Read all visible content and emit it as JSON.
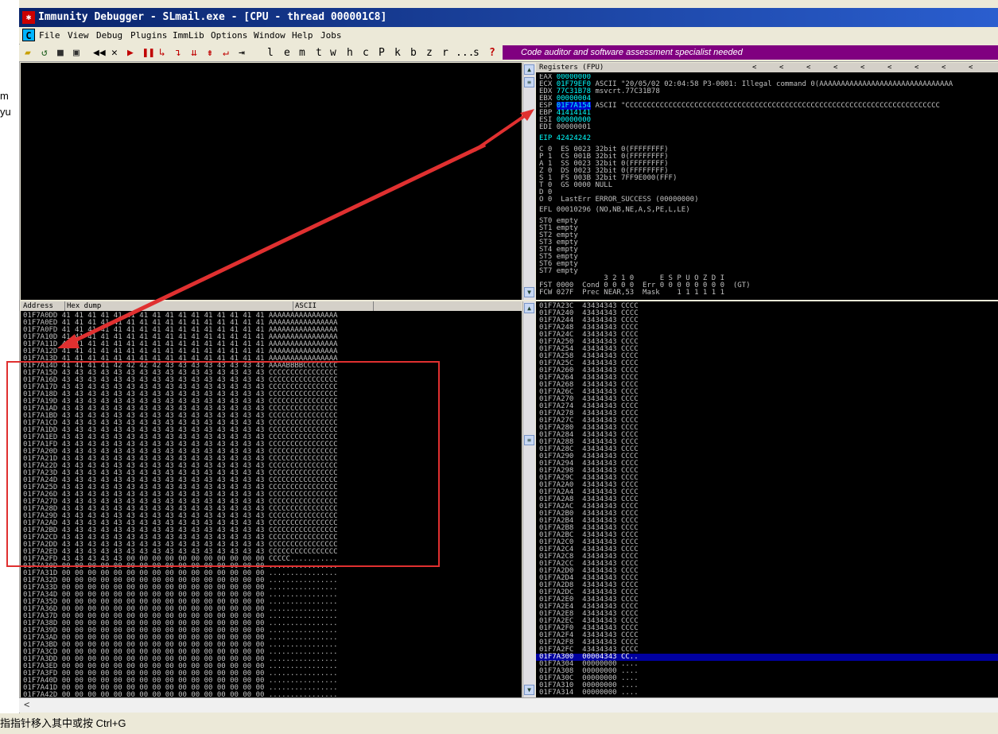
{
  "window": {
    "title": "Immunity Debugger - SLmail.exe - [CPU - thread 000001C8]"
  },
  "left_gutter": {
    "fragments": [
      "m",
      "yu"
    ]
  },
  "menu": {
    "icon_letter": "C",
    "items": [
      "File",
      "View",
      "Debug",
      "Plugins",
      "ImmLib",
      "Options",
      "Window",
      "Help",
      "Jobs"
    ]
  },
  "toolbar": {
    "letters": [
      "l",
      "e",
      "m",
      "t",
      "w",
      "h",
      "c",
      "P",
      "k",
      "b",
      "z",
      "r",
      "...",
      "s",
      "?"
    ],
    "banner": "Code auditor and software assessment specialist needed"
  },
  "registers": {
    "header": "Registers (FPU)",
    "lines": [
      {
        "name": "EAX",
        "value": "00000000",
        "rest": ""
      },
      {
        "name": "ECX",
        "value": "01F79EF0",
        "rest": "ASCII \"20/05/02 02:04:58 P3-0001: Illegal command 0(AAAAAAAAAAAAAAAAAAAAAAAAAAAAAAA"
      },
      {
        "name": "EDX",
        "value": "77C31B78",
        "rest": "msvcrt.77C31B78"
      },
      {
        "name": "EBX",
        "value": "00000004",
        "rest": ""
      },
      {
        "name": "ESP",
        "value": "01F7A154",
        "rest": "ASCII \"CCCCCCCCCCCCCCCCCCCCCCCCCCCCCCCCCCCCCCCCCCCCCCCCCCCCCCCCCCCCCCCCCCCCCCCCC"
      },
      {
        "name": "EBP",
        "value": "41414141",
        "rest": ""
      },
      {
        "name": "ESI",
        "value": "00000000",
        "rest": ""
      },
      {
        "name": "EDI",
        "value": "00000001",
        "rest": ""
      }
    ],
    "eip": "EIP 42424242",
    "flags": [
      "C 0  ES 0023 32bit 0(FFFFFFFF)",
      "P 1  CS 001B 32bit 0(FFFFFFFF)",
      "A 1  SS 0023 32bit 0(FFFFFFFF)",
      "Z 0  DS 0023 32bit 0(FFFFFFFF)",
      "S 1  FS 003B 32bit 7FF9E000(FFF)",
      "T 0  GS 0000 NULL",
      "D 0",
      "O 0  LastErr ERROR_SUCCESS (00000000)"
    ],
    "efl": "EFL 00010296 (NO,NB,NE,A,S,PE,L,LE)",
    "fpu": [
      "ST0 empty",
      "ST1 empty",
      "ST2 empty",
      "ST3 empty",
      "ST4 empty",
      "ST5 empty",
      "ST6 empty",
      "ST7 empty"
    ],
    "fpu_bits": "               3 2 1 0      E S P U O Z D I",
    "fst": "FST 0000  Cond 0 0 0 0  Err 0 0 0 0 0 0 0 0  (GT)",
    "fcw": "FCW 027F  Prec NEAR,53  Mask    1 1 1 1 1 1"
  },
  "dump": {
    "col_address": "Address",
    "col_hex": "Hex dump",
    "col_ascii": "ASCII",
    "rows": [
      "01F7A0DD 41 41 41 41 41 41 41 41 41 41 41 41 41 41 41 41 AAAAAAAAAAAAAAAA",
      "01F7A0ED 41 41 41 41 41 41 41 41 41 41 41 41 41 41 41 41 AAAAAAAAAAAAAAAA",
      "01F7A0FD 41 41 41 41 41 41 41 41 41 41 41 41 41 41 41 41 AAAAAAAAAAAAAAAA",
      "01F7A10D 41 41 41 41 41 41 41 41 41 41 41 41 41 41 41 41 AAAAAAAAAAAAAAAA",
      "01F7A11D 41 41 41 41 41 41 41 41 41 41 41 41 41 41 41 41 AAAAAAAAAAAAAAAA",
      "01F7A12D 41 41 41 41 41 41 41 41 41 41 41 41 41 41 41 41 AAAAAAAAAAAAAAAA",
      "01F7A13D 41 41 41 41 41 41 41 41 41 41 41 41 41 41 41 41 AAAAAAAAAAAAAAAA",
      "01F7A14D 41 41 41 41 42 42 42 42 43 43 43 43 43 43 43 43 AAAABBBBCCCCCCCC",
      "01F7A15D 43 43 43 43 43 43 43 43 43 43 43 43 43 43 43 43 CCCCCCCCCCCCCCCC",
      "01F7A16D 43 43 43 43 43 43 43 43 43 43 43 43 43 43 43 43 CCCCCCCCCCCCCCCC",
      "01F7A17D 43 43 43 43 43 43 43 43 43 43 43 43 43 43 43 43 CCCCCCCCCCCCCCCC",
      "01F7A18D 43 43 43 43 43 43 43 43 43 43 43 43 43 43 43 43 CCCCCCCCCCCCCCCC",
      "01F7A19D 43 43 43 43 43 43 43 43 43 43 43 43 43 43 43 43 CCCCCCCCCCCCCCCC",
      "01F7A1AD 43 43 43 43 43 43 43 43 43 43 43 43 43 43 43 43 CCCCCCCCCCCCCCCC",
      "01F7A1BD 43 43 43 43 43 43 43 43 43 43 43 43 43 43 43 43 CCCCCCCCCCCCCCCC",
      "01F7A1CD 43 43 43 43 43 43 43 43 43 43 43 43 43 43 43 43 CCCCCCCCCCCCCCCC",
      "01F7A1DD 43 43 43 43 43 43 43 43 43 43 43 43 43 43 43 43 CCCCCCCCCCCCCCCC",
      "01F7A1ED 43 43 43 43 43 43 43 43 43 43 43 43 43 43 43 43 CCCCCCCCCCCCCCCC",
      "01F7A1FD 43 43 43 43 43 43 43 43 43 43 43 43 43 43 43 43 CCCCCCCCCCCCCCCC",
      "01F7A20D 43 43 43 43 43 43 43 43 43 43 43 43 43 43 43 43 CCCCCCCCCCCCCCCC",
      "01F7A21D 43 43 43 43 43 43 43 43 43 43 43 43 43 43 43 43 CCCCCCCCCCCCCCCC",
      "01F7A22D 43 43 43 43 43 43 43 43 43 43 43 43 43 43 43 43 CCCCCCCCCCCCCCCC",
      "01F7A23D 43 43 43 43 43 43 43 43 43 43 43 43 43 43 43 43 CCCCCCCCCCCCCCCC",
      "01F7A24D 43 43 43 43 43 43 43 43 43 43 43 43 43 43 43 43 CCCCCCCCCCCCCCCC",
      "01F7A25D 43 43 43 43 43 43 43 43 43 43 43 43 43 43 43 43 CCCCCCCCCCCCCCCC",
      "01F7A26D 43 43 43 43 43 43 43 43 43 43 43 43 43 43 43 43 CCCCCCCCCCCCCCCC",
      "01F7A27D 43 43 43 43 43 43 43 43 43 43 43 43 43 43 43 43 CCCCCCCCCCCCCCCC",
      "01F7A28D 43 43 43 43 43 43 43 43 43 43 43 43 43 43 43 43 CCCCCCCCCCCCCCCC",
      "01F7A29D 43 43 43 43 43 43 43 43 43 43 43 43 43 43 43 43 CCCCCCCCCCCCCCCC",
      "01F7A2AD 43 43 43 43 43 43 43 43 43 43 43 43 43 43 43 43 CCCCCCCCCCCCCCCC",
      "01F7A2BD 43 43 43 43 43 43 43 43 43 43 43 43 43 43 43 43 CCCCCCCCCCCCCCCC",
      "01F7A2CD 43 43 43 43 43 43 43 43 43 43 43 43 43 43 43 43 CCCCCCCCCCCCCCCC",
      "01F7A2DD 43 43 43 43 43 43 43 43 43 43 43 43 43 43 43 43 CCCCCCCCCCCCCCCC",
      "01F7A2ED 43 43 43 43 43 43 43 43 43 43 43 43 43 43 43 43 CCCCCCCCCCCCCCCC",
      "01F7A2FD 43 43 43 43 43 00 00 00 00 00 00 00 00 00 00 00 CCCCC...........",
      "01F7A30D 00 00 00 00 00 00 00 00 00 00 00 00 00 00 00 00 ................",
      "01F7A31D 00 00 00 00 00 00 00 00 00 00 00 00 00 00 00 00 ................",
      "01F7A32D 00 00 00 00 00 00 00 00 00 00 00 00 00 00 00 00 ................",
      "01F7A33D 00 00 00 00 00 00 00 00 00 00 00 00 00 00 00 00 ................",
      "01F7A34D 00 00 00 00 00 00 00 00 00 00 00 00 00 00 00 00 ................",
      "01F7A35D 00 00 00 00 00 00 00 00 00 00 00 00 00 00 00 00 ................",
      "01F7A36D 00 00 00 00 00 00 00 00 00 00 00 00 00 00 00 00 ................",
      "01F7A37D 00 00 00 00 00 00 00 00 00 00 00 00 00 00 00 00 ................",
      "01F7A38D 00 00 00 00 00 00 00 00 00 00 00 00 00 00 00 00 ................",
      "01F7A39D 00 00 00 00 00 00 00 00 00 00 00 00 00 00 00 00 ................",
      "01F7A3AD 00 00 00 00 00 00 00 00 00 00 00 00 00 00 00 00 ................",
      "01F7A3BD 00 00 00 00 00 00 00 00 00 00 00 00 00 00 00 00 ................",
      "01F7A3CD 00 00 00 00 00 00 00 00 00 00 00 00 00 00 00 00 ................",
      "01F7A3DD 00 00 00 00 00 00 00 00 00 00 00 00 00 00 00 00 ................",
      "01F7A3ED 00 00 00 00 00 00 00 00 00 00 00 00 00 00 00 00 ................",
      "01F7A3FD 00 00 00 00 00 00 00 00 00 00 00 00 00 00 00 00 ................",
      "01F7A40D 00 00 00 00 00 00 00 00 00 00 00 00 00 00 00 00 ................",
      "01F7A41D 00 00 00 00 00 00 00 00 00 00 00 00 00 00 00 00 ................",
      "01F7A42D 00 00 00 00 00 00 00 00 00 00 00 00 00 00 00 00 ................"
    ]
  },
  "stack": {
    "rows": [
      "01F7A23C  43434343 CCCC",
      "01F7A240  43434343 CCCC",
      "01F7A244  43434343 CCCC",
      "01F7A248  43434343 CCCC",
      "01F7A24C  43434343 CCCC",
      "01F7A250  43434343 CCCC",
      "01F7A254  43434343 CCCC",
      "01F7A258  43434343 CCCC",
      "01F7A25C  43434343 CCCC",
      "01F7A260  43434343 CCCC",
      "01F7A264  43434343 CCCC",
      "01F7A268  43434343 CCCC",
      "01F7A26C  43434343 CCCC",
      "01F7A270  43434343 CCCC",
      "01F7A274  43434343 CCCC",
      "01F7A278  43434343 CCCC",
      "01F7A27C  43434343 CCCC",
      "01F7A280  43434343 CCCC",
      "01F7A284  43434343 CCCC",
      "01F7A288  43434343 CCCC",
      "01F7A28C  43434343 CCCC",
      "01F7A290  43434343 CCCC",
      "01F7A294  43434343 CCCC",
      "01F7A298  43434343 CCCC",
      "01F7A29C  43434343 CCCC",
      "01F7A2A0  43434343 CCCC",
      "01F7A2A4  43434343 CCCC",
      "01F7A2A8  43434343 CCCC",
      "01F7A2AC  43434343 CCCC",
      "01F7A2B0  43434343 CCCC",
      "01F7A2B4  43434343 CCCC",
      "01F7A2B8  43434343 CCCC",
      "01F7A2BC  43434343 CCCC",
      "01F7A2C0  43434343 CCCC",
      "01F7A2C4  43434343 CCCC",
      "01F7A2C8  43434343 CCCC",
      "01F7A2CC  43434343 CCCC",
      "01F7A2D0  43434343 CCCC",
      "01F7A2D4  43434343 CCCC",
      "01F7A2D8  43434343 CCCC",
      "01F7A2DC  43434343 CCCC",
      "01F7A2E0  43434343 CCCC",
      "01F7A2E4  43434343 CCCC",
      "01F7A2E8  43434343 CCCC",
      "01F7A2EC  43434343 CCCC",
      "01F7A2F0  43434343 CCCC",
      "01F7A2F4  43434343 CCCC",
      "01F7A2F8  43434343 CCCC",
      "01F7A2FC  43434343 CCCC",
      "01F7A300  00004343 CC..",
      "01F7A304  00000000 ....",
      "01F7A308  00000000 ....",
      "01F7A30C  00000000 ....",
      "01F7A310  00000000 ....",
      "01F7A314  00000000 ...."
    ],
    "highlight_index": 49
  },
  "status_bar": {
    "text": "指指针移入其中或按 Ctrl+G"
  },
  "colors": {
    "title_bg": "#0a246a",
    "banner_bg": "#800080",
    "pane_bg": "#000000",
    "annotation_red": "#e03030"
  }
}
